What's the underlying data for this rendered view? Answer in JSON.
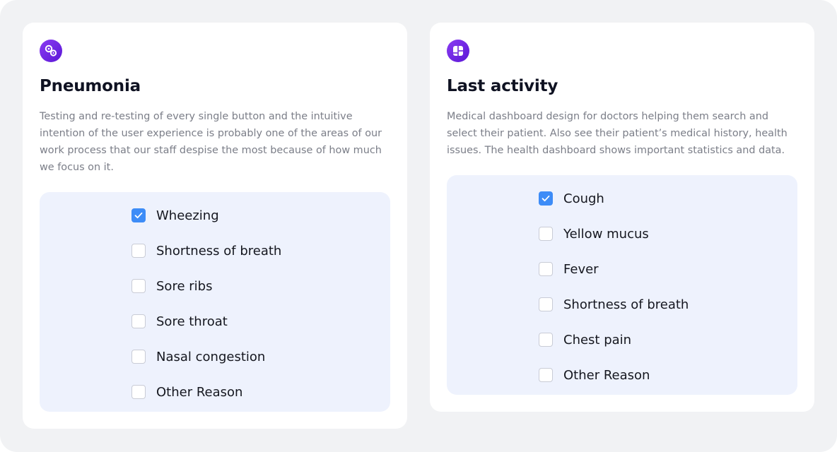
{
  "accent_color": "#6d28d9",
  "checkbox_checked_color": "#3d8cf7",
  "cards": [
    {
      "icon": "location-pins-icon",
      "title": "Pneumonia",
      "description": "Testing and re-testing of every single button and the intuitive intention of the user experience is probably one of the areas of our work process that our staff despise the most because of how much we focus on it.",
      "options": [
        {
          "label": "Wheezing",
          "checked": true
        },
        {
          "label": "Shortness of breath",
          "checked": false
        },
        {
          "label": "Sore ribs",
          "checked": false
        },
        {
          "label": "Sore throat",
          "checked": false
        },
        {
          "label": "Nasal congestion",
          "checked": false
        },
        {
          "label": "Other Reason",
          "checked": false
        }
      ]
    },
    {
      "icon": "layout-panels-icon",
      "title": "Last activity",
      "description": "Medical dashboard design for doctors helping them search and select their patient. Also see their patient’s medical history, health issues. The health dashboard shows important statistics and data.",
      "options": [
        {
          "label": "Cough",
          "checked": true
        },
        {
          "label": "Yellow mucus",
          "checked": false
        },
        {
          "label": "Fever",
          "checked": false
        },
        {
          "label": "Shortness of breath",
          "checked": false
        },
        {
          "label": "Chest pain",
          "checked": false
        },
        {
          "label": "Other Reason",
          "checked": false
        }
      ]
    }
  ]
}
